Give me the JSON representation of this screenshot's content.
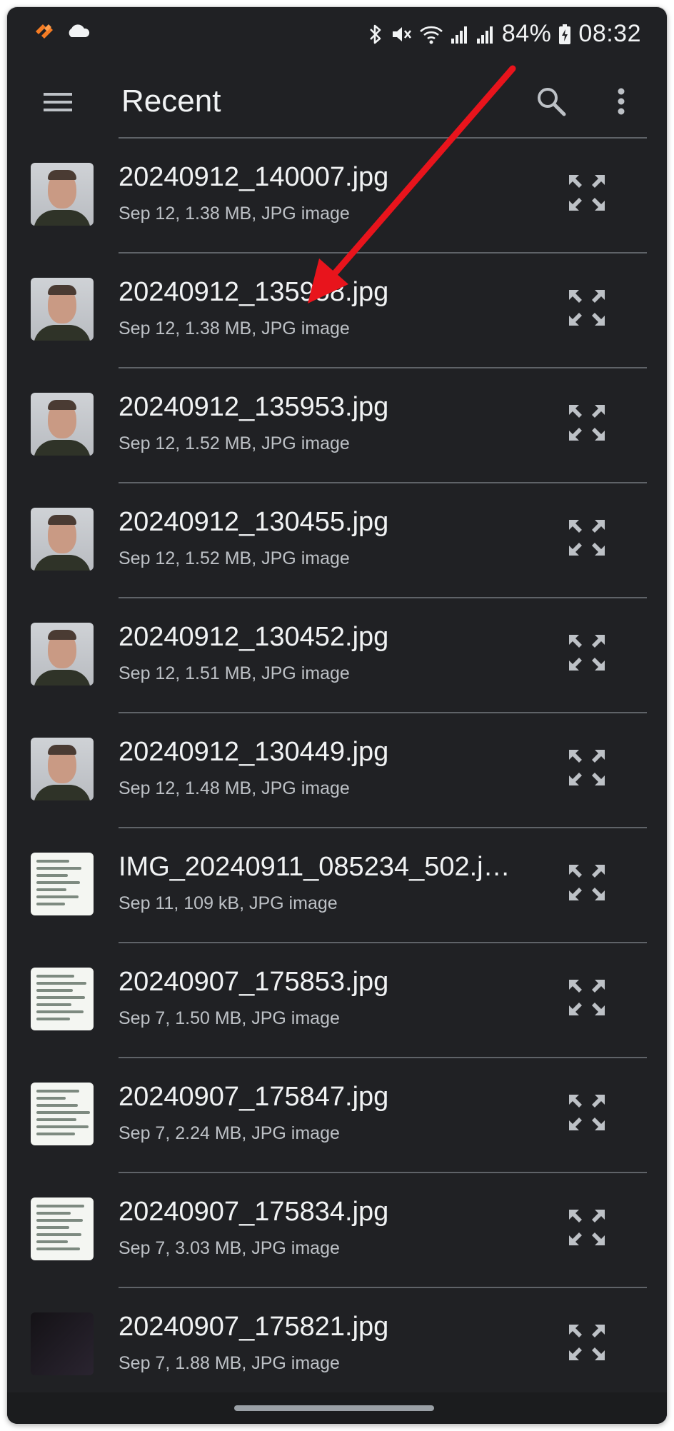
{
  "status_bar": {
    "left_icons": [
      "app-notification-icon",
      "cloud-icon"
    ],
    "right_icons": [
      "bluetooth-icon",
      "mute-icon",
      "wifi-icon",
      "signal-icon",
      "signal-icon",
      "battery-charging-icon"
    ],
    "battery": "84%",
    "time": "08:32"
  },
  "app_bar": {
    "title": "Recent",
    "menu_icon": "hamburger-menu-icon",
    "search_icon": "search-icon",
    "more_icon": "more-vert-icon"
  },
  "files": [
    {
      "name": "20240912_140007.jpg",
      "meta": "Sep 12, 1.38 MB, JPG image",
      "thumb": "face"
    },
    {
      "name": "20240912_135958.jpg",
      "meta": "Sep 12, 1.38 MB, JPG image",
      "thumb": "face"
    },
    {
      "name": "20240912_135953.jpg",
      "meta": "Sep 12, 1.52 MB, JPG image",
      "thumb": "face"
    },
    {
      "name": "20240912_130455.jpg",
      "meta": "Sep 12, 1.52 MB, JPG image",
      "thumb": "face"
    },
    {
      "name": "20240912_130452.jpg",
      "meta": "Sep 12, 1.51 MB, JPG image",
      "thumb": "face"
    },
    {
      "name": "20240912_130449.jpg",
      "meta": "Sep 12, 1.48 MB, JPG image",
      "thumb": "face"
    },
    {
      "name": "IMG_20240911_085234_502.j…",
      "meta": "Sep 11, 109 kB, JPG image",
      "thumb": "doc"
    },
    {
      "name": "20240907_175853.jpg",
      "meta": "Sep 7, 1.50 MB, JPG image",
      "thumb": "doc"
    },
    {
      "name": "20240907_175847.jpg",
      "meta": "Sep 7, 2.24 MB, JPG image",
      "thumb": "doc"
    },
    {
      "name": "20240907_175834.jpg",
      "meta": "Sep 7, 3.03 MB, JPG image",
      "thumb": "doc"
    },
    {
      "name": "20240907_175821.jpg",
      "meta": "Sep 7, 1.88 MB, JPG image",
      "thumb": "dark"
    }
  ],
  "row_action_icon": "expand-icon",
  "annotation": {
    "type": "arrow",
    "color": "#e8141c",
    "points_to": "20240912_135958.jpg"
  },
  "colors": {
    "background": "#202124",
    "divider": "#5f6368",
    "primary_text": "#f1f3f4",
    "secondary_text": "#bdc1c6"
  }
}
